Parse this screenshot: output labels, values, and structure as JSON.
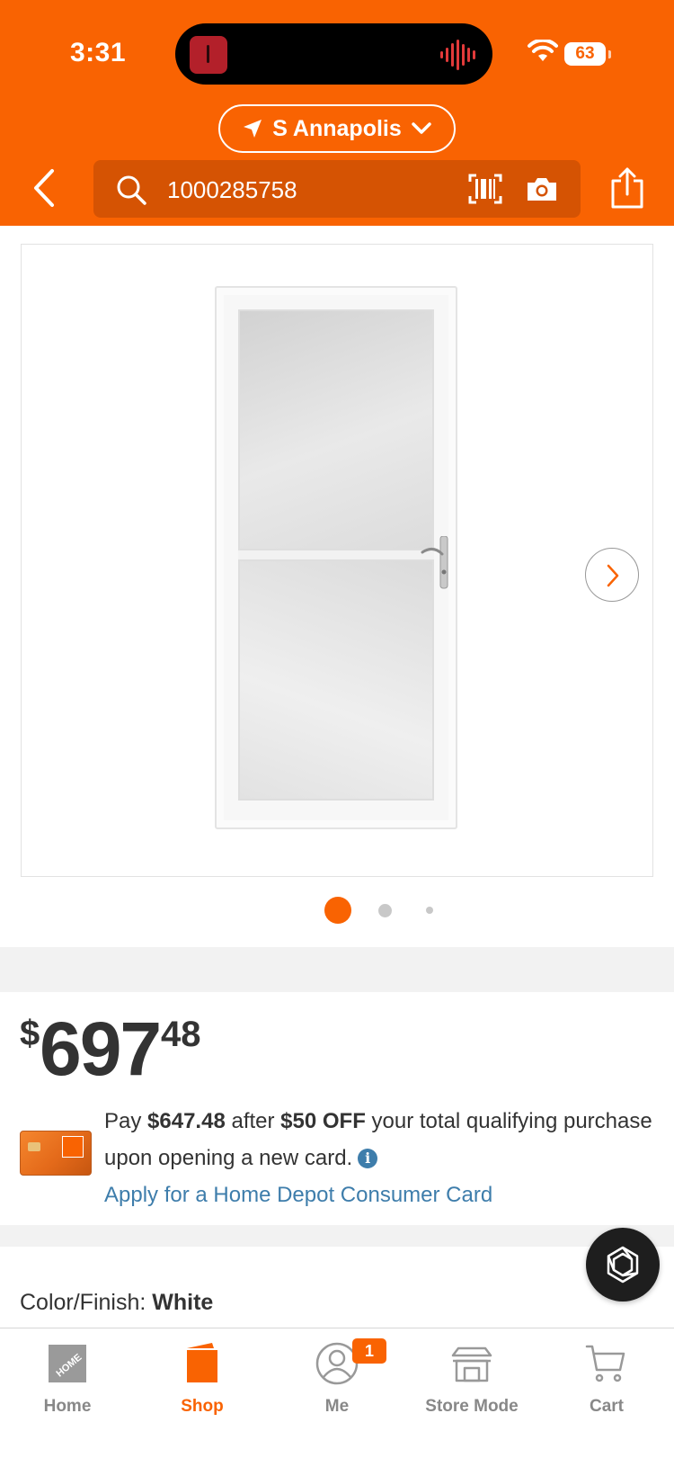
{
  "status_bar": {
    "time": "3:31",
    "battery": "63"
  },
  "header": {
    "location": "S Annapolis",
    "search_value": "1000285758"
  },
  "gallery": {
    "total_dots": 3,
    "active_index": 0
  },
  "price": {
    "dollar_sign": "$",
    "whole": "697",
    "cents": "48"
  },
  "promo": {
    "pay_prefix": "Pay ",
    "discounted_price": "$647.48",
    "after": " after ",
    "discount": "$50 OFF",
    "rest": " your total qualifying purchase upon opening a new card.",
    "info": "i",
    "apply_link": "Apply for a Home Depot Consumer Card"
  },
  "color_finish": {
    "label": "Color/Finish: ",
    "value": "White"
  },
  "tabs": [
    {
      "label": "Home",
      "icon": "home-depot-logo-icon",
      "active": false
    },
    {
      "label": "Shop",
      "icon": "shop-bucket-icon",
      "active": true
    },
    {
      "label": "Me",
      "icon": "profile-icon",
      "active": false,
      "badge": "1"
    },
    {
      "label": "Store Mode",
      "icon": "store-icon",
      "active": false
    },
    {
      "label": "Cart",
      "icon": "cart-icon",
      "active": false
    }
  ],
  "colors": {
    "brand_orange": "#f96302",
    "search_bg": "#d55303",
    "link_blue": "#3e7dab"
  }
}
